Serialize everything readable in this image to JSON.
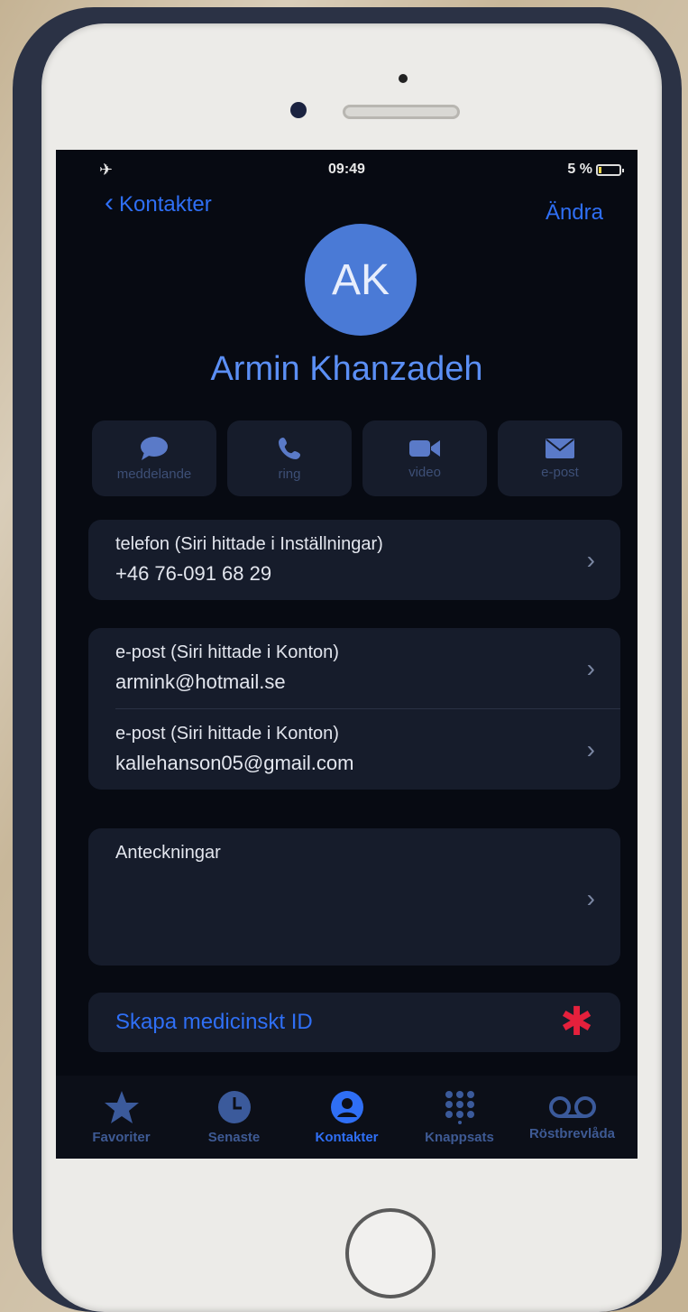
{
  "status_bar": {
    "time": "09:49",
    "battery": "5 %"
  },
  "nav": {
    "back_label": "Kontakter",
    "edit_label": "Ändra"
  },
  "contact": {
    "initials": "AK",
    "name": "Armin Khanzadeh"
  },
  "actions": [
    {
      "label": "meddelande",
      "icon": "message-icon"
    },
    {
      "label": "ring",
      "icon": "phone-icon"
    },
    {
      "label": "video",
      "icon": "video-icon"
    },
    {
      "label": "e-post",
      "icon": "mail-icon"
    }
  ],
  "phone": {
    "label": "telefon (Siri hittade i Inställningar)",
    "value": "+46 76-091 68 29"
  },
  "emails": [
    {
      "label": "e-post (Siri hittade i Konton)",
      "value": "armink@hotmail.se"
    },
    {
      "label": "e-post (Siri hittade i Konton)",
      "value": "kallehanson05@gmail.com"
    }
  ],
  "notes": {
    "label": "Anteckningar"
  },
  "medical": {
    "label": "Skapa medicinskt ID",
    "icon": "asterisk-icon",
    "icon_color": "#e5203c"
  },
  "tabs": [
    {
      "label": "Favoriter",
      "icon": "star-icon",
      "active": false
    },
    {
      "label": "Senaste",
      "icon": "clock-icon",
      "active": false
    },
    {
      "label": "Kontakter",
      "icon": "person-circle-icon",
      "active": true
    },
    {
      "label": "Knappsats",
      "icon": "keypad-icon",
      "active": false
    },
    {
      "label": "Röstbrevlåda",
      "icon": "voicemail-icon",
      "active": false
    }
  ],
  "colors": {
    "accent": "#2f6ff5",
    "screen_bg": "#070a12",
    "card_bg": "#161c2b"
  }
}
